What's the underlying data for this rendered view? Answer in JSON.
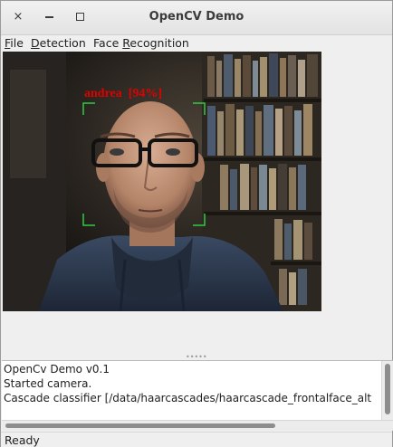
{
  "window": {
    "title": "OpenCV Demo",
    "close_glyph": "×",
    "icons": [
      "close-icon",
      "minimize-icon",
      "maximize-icon"
    ]
  },
  "menu": {
    "file": {
      "mnemonic": "F",
      "rest": "ile"
    },
    "detection": {
      "mnemonic": "D",
      "rest": "etection"
    },
    "face_recognition": {
      "prefix": "Face ",
      "mnemonic": "R",
      "rest": "ecognition"
    }
  },
  "video": {
    "detection_label": "andrea  [94%]",
    "label_color": "#e00000",
    "box_color": "#2ecc40"
  },
  "log": {
    "lines": [
      "OpenCv Demo v0.1",
      "Started camera.",
      "Cascade classifier [/data/haarcascades/haarcascade_frontalface_alt"
    ]
  },
  "splitter": {
    "grip": "•••••"
  },
  "status": {
    "text": "Ready"
  }
}
